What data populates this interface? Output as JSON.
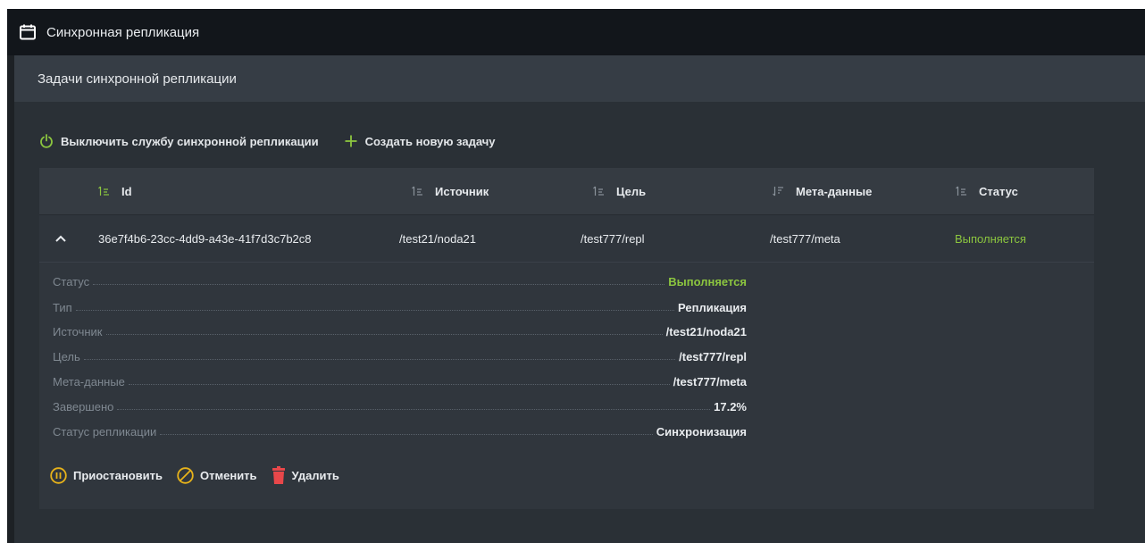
{
  "window": {
    "title": "Синхронная репликация",
    "icon": "calendar-icon"
  },
  "panel": {
    "title": "Задачи синхронной репликации"
  },
  "toolbar": {
    "disable_service_label": "Выключить службу синхронной репликации",
    "create_task_label": "Создать новую задачу"
  },
  "table": {
    "columns": [
      "Id",
      "Источник",
      "Цель",
      "Мета-данные",
      "Статус"
    ],
    "rows": [
      {
        "id": "36e7f4b6-23cc-4dd9-a43e-41f7d3c7b2c8",
        "source": "/test21/noda21",
        "target": "/test777/repl",
        "meta": "/test777/meta",
        "status": "Выполняется",
        "expanded": true
      }
    ]
  },
  "details": {
    "fields": [
      {
        "label": "Статус",
        "value": "Выполняется"
      },
      {
        "label": "Тип",
        "value": "Репликация"
      },
      {
        "label": "Источник",
        "value": "/test21/noda21"
      },
      {
        "label": "Цель",
        "value": "/test777/repl"
      },
      {
        "label": "Мета-данные",
        "value": "/test777/meta"
      },
      {
        "label": "Завершено",
        "value": "17.2%"
      },
      {
        "label": "Статус репликации",
        "value": "Синхронизация"
      }
    ]
  },
  "actions": {
    "pause_label": "Приостановить",
    "cancel_label": "Отменить",
    "delete_label": "Удалить"
  },
  "colors": {
    "accent_green": "#8cc63f",
    "warning_yellow": "#e8b31a",
    "danger_red": "#e8474a"
  }
}
